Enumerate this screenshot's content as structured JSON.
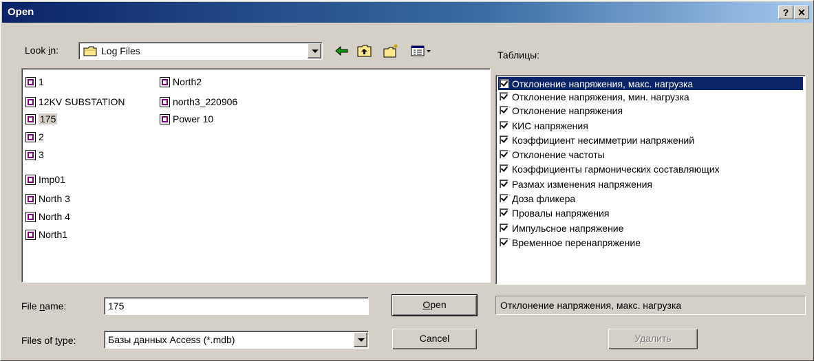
{
  "window": {
    "title": "Open",
    "help_glyph": "?",
    "close_glyph": "✕"
  },
  "lookin": {
    "label_pre": "Look ",
    "label_accel": "i",
    "label_post": "n:",
    "value": "Log Files"
  },
  "toolbar": {
    "icons": [
      "back-icon",
      "up-folder-icon",
      "new-folder-icon",
      "view-menu-icon"
    ]
  },
  "files": [
    {
      "name": "1",
      "selected": false
    },
    {
      "name": "12KV SUBSTATION",
      "selected": false
    },
    {
      "name": "175",
      "selected": true
    },
    {
      "name": "2",
      "selected": false
    },
    {
      "name": "3",
      "selected": false
    },
    {
      "name": "Imp01",
      "selected": false
    },
    {
      "name": "North 3",
      "selected": false
    },
    {
      "name": "North 4",
      "selected": false
    },
    {
      "name": "North1",
      "selected": false
    },
    {
      "name": "North2",
      "selected": false
    },
    {
      "name": "north3_220906",
      "selected": false
    },
    {
      "name": "Power 10",
      "selected": false
    }
  ],
  "tables": {
    "label": "Таблицы:",
    "items": [
      {
        "label": "Отклонение напряжения, макс. нагрузка",
        "checked": true,
        "selected": true
      },
      {
        "label": "Отклонение напряжения, мин. нагрузка",
        "checked": true,
        "selected": false
      },
      {
        "label": "Отклонение напряжения",
        "checked": true,
        "selected": false
      },
      {
        "label": "КИС напряжения",
        "checked": true,
        "selected": false
      },
      {
        "label": "Коэффициент несимметрии напряжений",
        "checked": true,
        "selected": false
      },
      {
        "label": "Отклонение частоты",
        "checked": true,
        "selected": false
      },
      {
        "label": "Коэффициенты гармонических составляющих",
        "checked": true,
        "selected": false
      },
      {
        "label": "Размах изменения напряжения",
        "checked": true,
        "selected": false
      },
      {
        "label": "Доза фликера",
        "checked": true,
        "selected": false
      },
      {
        "label": "Провалы напряжения",
        "checked": true,
        "selected": false
      },
      {
        "label": "Импульсное напряжение",
        "checked": true,
        "selected": false
      },
      {
        "label": "Временное перенапряжение",
        "checked": true,
        "selected": false
      }
    ],
    "selected_display": "Отклонение напряжения, макс. нагрузка",
    "delete_label": "Удалить"
  },
  "filename": {
    "label_pre": "File ",
    "label_accel": "n",
    "label_post": "ame:",
    "value": "175"
  },
  "filetype": {
    "label_pre": "Files of ",
    "label_accel": "t",
    "label_post": "ype:",
    "value": "Базы данных Access (*.mdb)"
  },
  "buttons": {
    "open_accel": "O",
    "open_rest": "pen",
    "cancel": "Cancel"
  },
  "colors": {
    "face": "#d4d0c8",
    "selection": "#0a246a",
    "title_gradient_start": "#0a246a",
    "title_gradient_end": "#a6caf0"
  }
}
